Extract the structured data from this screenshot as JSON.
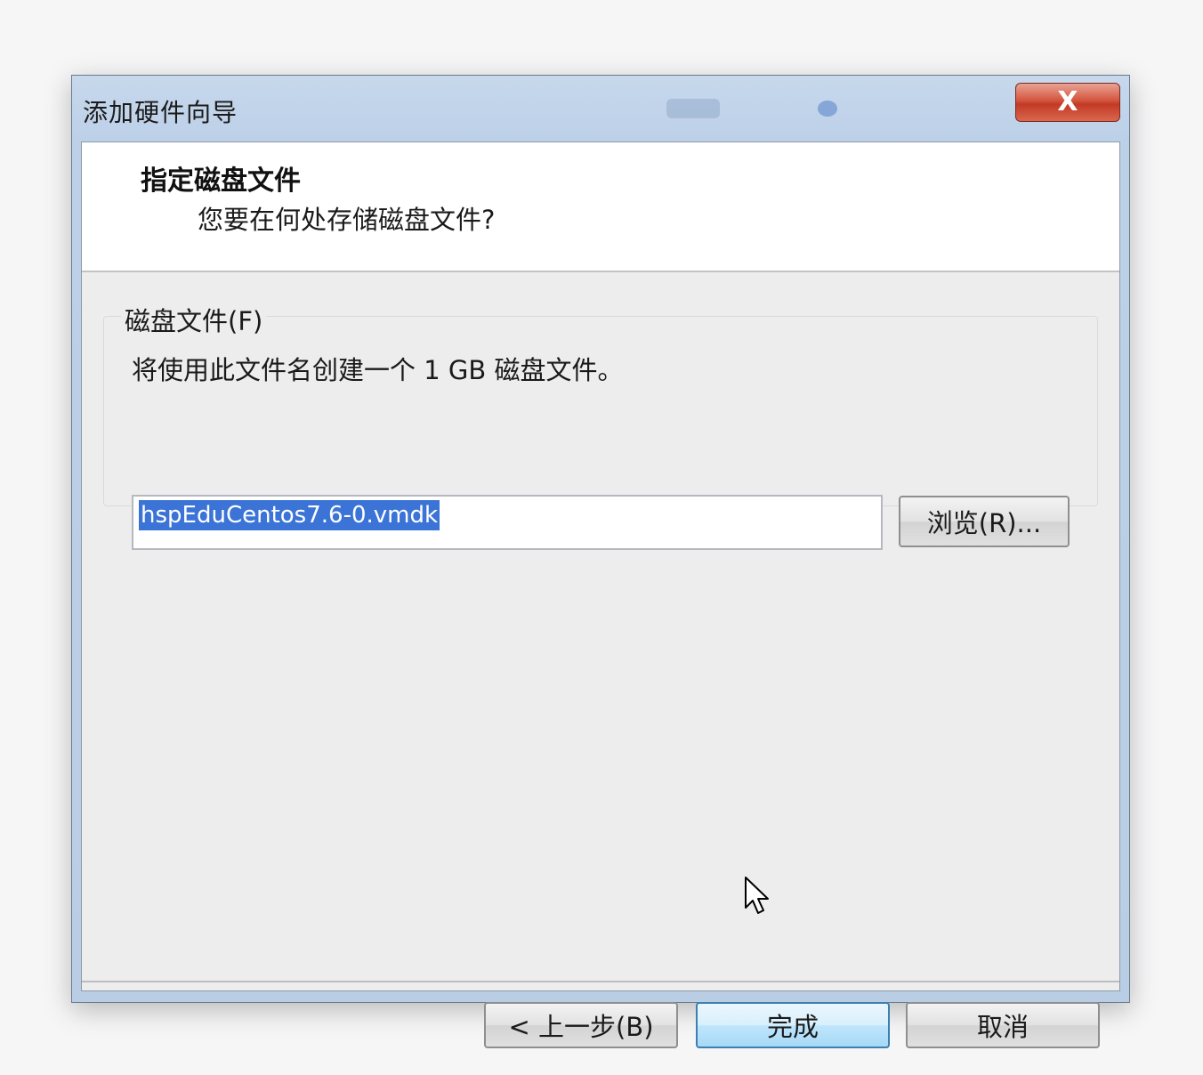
{
  "window": {
    "title": "添加硬件向导",
    "close_glyph": "X"
  },
  "header": {
    "title": "指定磁盘文件",
    "subtitle": "您要在何处存储磁盘文件?"
  },
  "disk_file_group": {
    "legend": "磁盘文件(F)",
    "description": "将使用此文件名创建一个 1 GB 磁盘文件。",
    "filename_value": "hspEduCentos7.6-0.vmdk",
    "browse_label": "浏览(R)..."
  },
  "footer": {
    "back_label": "< 上一步(B)",
    "finish_label": "完成",
    "cancel_label": "取消"
  },
  "colors": {
    "selection": "#3b74d6",
    "close_button": "#c23a24",
    "default_button_border": "#3c7fb1"
  },
  "icons": {
    "close": "close-icon",
    "cursor": "mouse-pointer-icon"
  }
}
